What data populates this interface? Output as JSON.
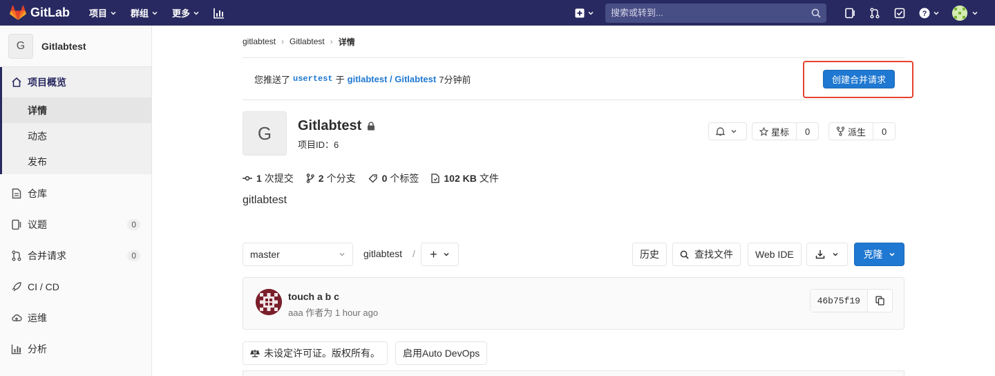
{
  "topnav": {
    "brand": "GitLab",
    "menu": [
      {
        "label": "项目"
      },
      {
        "label": "群组"
      },
      {
        "label": "更多"
      }
    ],
    "search_placeholder": "搜索或转到..."
  },
  "sidebar": {
    "project_initial": "G",
    "project_name": "Gitlabtest",
    "overview_label": "项目概览",
    "sub_items": [
      {
        "label": "详情"
      },
      {
        "label": "动态"
      },
      {
        "label": "发布"
      }
    ],
    "items": [
      {
        "label": "仓库",
        "icon": "doc-icon"
      },
      {
        "label": "议题",
        "icon": "issues-icon",
        "count": "0"
      },
      {
        "label": "合并请求",
        "icon": "merge-request-icon",
        "count": "0"
      },
      {
        "label": "CI / CD",
        "icon": "rocket-icon"
      },
      {
        "label": "运维",
        "icon": "cloud-icon"
      },
      {
        "label": "分析",
        "icon": "chart-icon"
      }
    ]
  },
  "breadcrumb": {
    "items": [
      "gitlabtest",
      "Gitlabtest",
      "详情"
    ]
  },
  "push_banner": {
    "prefix": "您推送了",
    "branch": "usertest",
    "middle": "于",
    "project": "gitlabtest / Gitlabtest",
    "suffix": "7分钟前",
    "button_label": "创建合并请求"
  },
  "project": {
    "initial": "G",
    "title": "Gitlabtest",
    "id_text": "项目ID：6",
    "star_label": "星标",
    "star_count": "0",
    "fork_label": "派生",
    "fork_count": "0",
    "description": "gitlabtest"
  },
  "stats": [
    {
      "value": "1",
      "label": "次提交",
      "icon": "commit-icon"
    },
    {
      "value": "2",
      "label": "个分支",
      "icon": "branch-icon"
    },
    {
      "value": "0",
      "label": "个标签",
      "icon": "tag-icon"
    },
    {
      "value": "102 KB",
      "label": "文件",
      "icon": "file-icon"
    }
  ],
  "toolbar": {
    "branch": "master",
    "path": "gitlabtest",
    "path_sep": "/",
    "add_label": "+",
    "history_label": "历史",
    "find_file_label": "查找文件",
    "web_ide_label": "Web IDE",
    "clone_label": "克隆"
  },
  "commit": {
    "title": "touch a b c",
    "meta": "aaa 作者为 1 hour ago",
    "sha": "46b75f19"
  },
  "bottom": {
    "license_label": "未设定许可证。版权所有。",
    "auto_devops_label": "启用Auto DevOps"
  },
  "colors": {
    "nav_bg": "#292961",
    "primary": "#1f78d1",
    "highlight": "#e8412c"
  }
}
